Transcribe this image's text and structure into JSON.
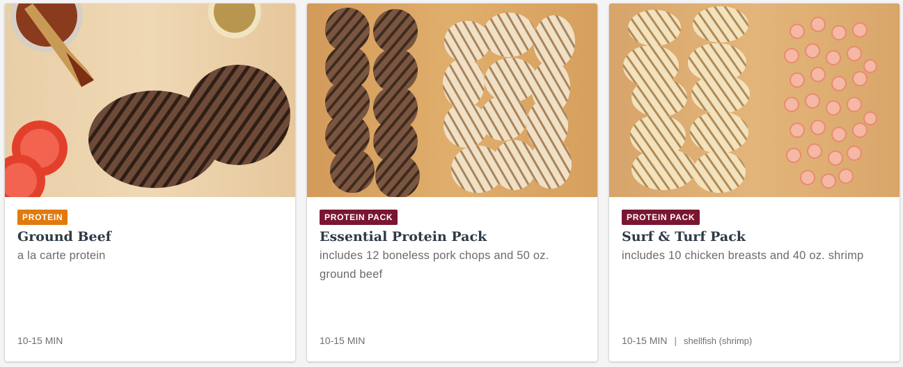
{
  "colors": {
    "badge_protein": "#e07a0d",
    "badge_protein_pack": "#7a1630",
    "title": "#2e3a46",
    "subtitle": "#6b6b6b"
  },
  "cards": [
    {
      "image_icon": "ground-beef-patties-photo",
      "badge": "PROTEIN",
      "title": "Ground Beef",
      "subtitle": "a la carte protein",
      "time": "10-15 MIN",
      "allergens": ""
    },
    {
      "image_icon": "pork-chops-and-ground-beef-photo",
      "badge": "PROTEIN PACK",
      "title": "Essential Protein Pack",
      "subtitle": "includes 12 boneless pork chops and 50 oz. ground beef",
      "time": "10-15 MIN",
      "allergens": ""
    },
    {
      "image_icon": "chicken-and-shrimp-photo",
      "badge": "PROTEIN PACK",
      "title": "Surf & Turf Pack",
      "subtitle": "includes 10 chicken breasts and 40 oz. shrimp",
      "time": "10-15 MIN",
      "separator": "|",
      "allergens": "shellfish (shrimp)"
    }
  ]
}
